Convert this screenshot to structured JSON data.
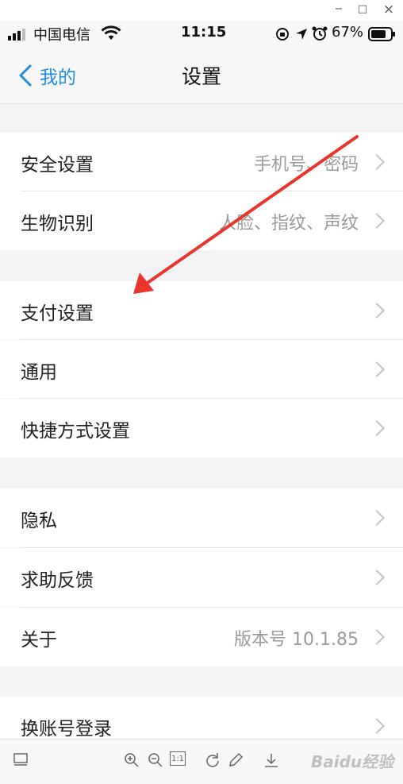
{
  "window": {
    "minimize": "−",
    "maximize": "□",
    "close": "×"
  },
  "status_bar": {
    "carrier": "中国电信",
    "time": "11:15",
    "battery": "67%"
  },
  "nav": {
    "back_label": "我的",
    "title": "设置"
  },
  "groups": [
    {
      "items": [
        {
          "label": "安全设置",
          "value": "手机号、密码"
        },
        {
          "label": "生物识别",
          "value": "人脸、指纹、声纹"
        }
      ]
    },
    {
      "items": [
        {
          "label": "支付设置",
          "value": ""
        },
        {
          "label": "通用",
          "value": ""
        },
        {
          "label": "快捷方式设置",
          "value": ""
        }
      ]
    },
    {
      "items": [
        {
          "label": "隐私",
          "value": ""
        },
        {
          "label": "求助反馈",
          "value": ""
        },
        {
          "label": "关于",
          "value": "版本号 10.1.85"
        }
      ]
    },
    {
      "items": [
        {
          "label": "换账号登录",
          "value": ""
        }
      ]
    }
  ],
  "toolbar": {
    "fit_label": "1:1"
  },
  "watermark": {
    "text": "Baidu经验"
  },
  "colors": {
    "accent": "#1e8ce6",
    "arrow": "#e8362c",
    "background": "#f3f3f5"
  }
}
